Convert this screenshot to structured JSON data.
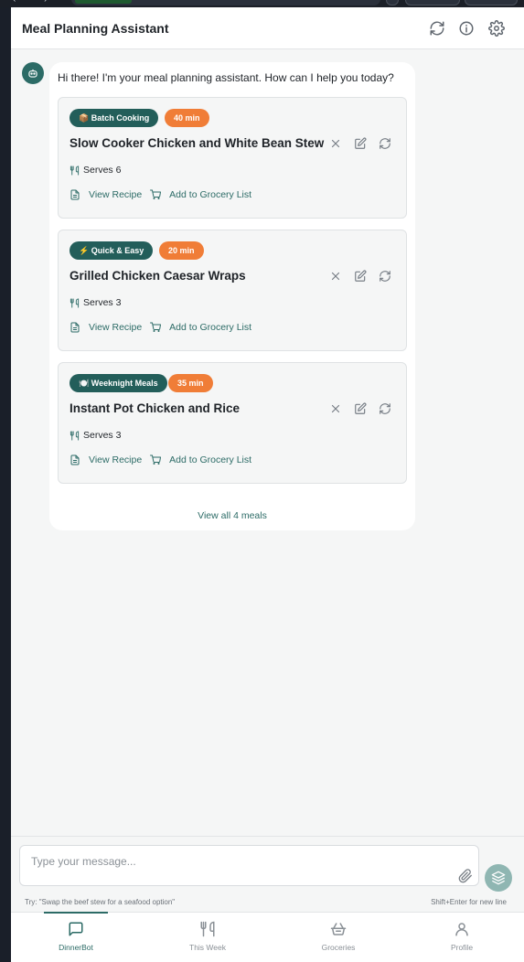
{
  "header": {
    "title": "Meal Planning Assistant",
    "icons": [
      "refresh-icon",
      "info-icon",
      "settings-icon"
    ]
  },
  "chat": {
    "greeting": "Hi there! I'm your meal planning assistant. How can I help you today?",
    "meals": [
      {
        "emoji": "📦",
        "category": "Batch Cooking",
        "time": "40 min",
        "title": "Slow Cooker Chicken and White Bean Stew",
        "serves": "Serves 6"
      },
      {
        "emoji": "⚡",
        "category": "Quick & Easy",
        "time": "20 min",
        "title": "Grilled Chicken Caesar Wraps",
        "serves": "Serves 3"
      },
      {
        "emoji": "🍽️",
        "category": "Weeknight Meals",
        "time": "35 min",
        "title": "Instant Pot Chicken and Rice",
        "serves": "Serves 3"
      }
    ],
    "view_recipe_label": "View Recipe",
    "add_grocery_label": "Add to Grocery List",
    "view_all_label": "View all 4 meals"
  },
  "composer": {
    "placeholder": "Type your message...",
    "hint_left": "Try: \"Swap the beef stew for a seafood option\"",
    "hint_right": "Shift+Enter for new line"
  },
  "bottom_nav": {
    "items": [
      {
        "label": "DinnerBot",
        "icon": "chat-icon",
        "active": true
      },
      {
        "label": "This Week",
        "icon": "utensils-icon",
        "active": false
      },
      {
        "label": "Groceries",
        "icon": "basket-icon",
        "active": false
      },
      {
        "label": "Profile",
        "icon": "user-icon",
        "active": false
      }
    ]
  },
  "colors": {
    "brand_teal": "#235e5a",
    "accent_orange": "#f07d37",
    "link_teal": "#2c6b66"
  }
}
